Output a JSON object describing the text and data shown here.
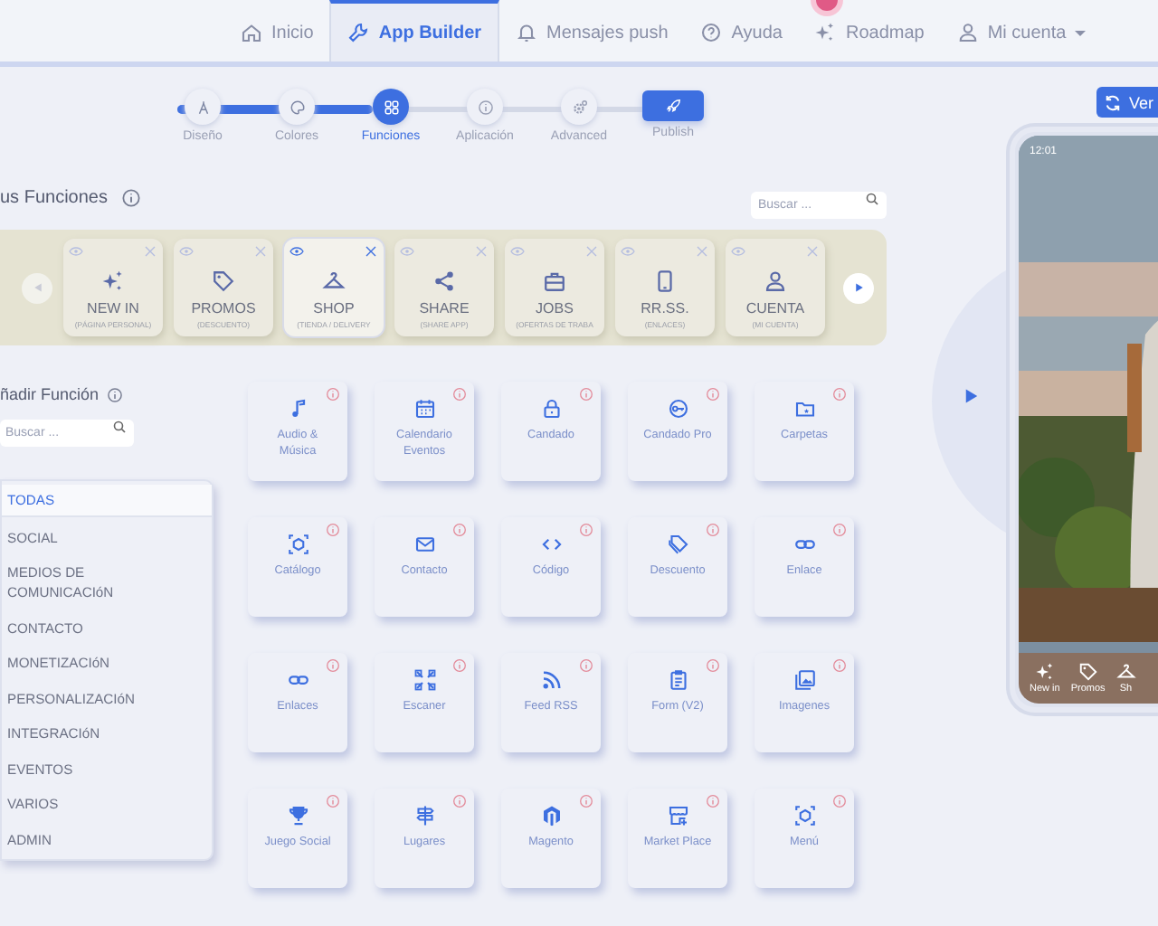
{
  "nav": {
    "items": [
      {
        "label": "Inicio",
        "selected": false
      },
      {
        "label": "App Builder",
        "selected": true
      },
      {
        "label": "Mensajes push",
        "selected": false
      },
      {
        "label": "Ayuda",
        "selected": false
      },
      {
        "label": "Roadmap",
        "selected": false
      },
      {
        "label": "Mi cuenta",
        "selected": false
      }
    ]
  },
  "stepper": {
    "steps": [
      {
        "label": "Diseño",
        "kind": "step",
        "done": true,
        "selected": false
      },
      {
        "label": "Colores",
        "kind": "step",
        "done": true,
        "selected": false
      },
      {
        "label": "Funciones",
        "kind": "step",
        "done": false,
        "selected": true
      },
      {
        "label": "Aplicación",
        "kind": "step",
        "done": false,
        "selected": false
      },
      {
        "label": "Advanced",
        "kind": "step",
        "done": false,
        "selected": false
      },
      {
        "label": "Publish",
        "kind": "button",
        "done": false,
        "selected": false
      }
    ]
  },
  "my_functions": {
    "title": "us Funciones",
    "search": {
      "placeholder": "Buscar ..."
    },
    "cards": [
      {
        "title": "NEW IN",
        "subtitle": "(PÁGINA PERSONAL)",
        "selected": false
      },
      {
        "title": "PROMOS",
        "subtitle": "(DESCUENTO)",
        "selected": false
      },
      {
        "title": "SHOP",
        "subtitle": "(TIENDA / DELIVERY",
        "selected": true
      },
      {
        "title": "SHARE",
        "subtitle": "(SHARE APP)",
        "selected": false
      },
      {
        "title": "JOBS",
        "subtitle": "(OFERTAS DE TRABA",
        "selected": false
      },
      {
        "title": "RR.SS.",
        "subtitle": "(ENLACES)",
        "selected": false
      },
      {
        "title": "CUENTA",
        "subtitle": "(MI CUENTA)",
        "selected": false
      }
    ]
  },
  "add_function": {
    "title": "ñadir Función",
    "search": {
      "placeholder": "Buscar ..."
    },
    "categories": [
      {
        "label": "TODAS",
        "selected": true
      },
      {
        "label": "SOCIAL",
        "selected": false
      },
      {
        "label": "MEDIOS DE COMUNICACIóN",
        "selected": false
      },
      {
        "label": "CONTACTO",
        "selected": false
      },
      {
        "label": "MONETIZACIóN",
        "selected": false
      },
      {
        "label": "PERSONALIZACIóN",
        "selected": false
      },
      {
        "label": "INTEGRACIóN",
        "selected": false
      },
      {
        "label": "EVENTOS",
        "selected": false
      },
      {
        "label": "VARIOS",
        "selected": false
      },
      {
        "label": "ADMIN",
        "selected": false
      }
    ],
    "functions": [
      {
        "label": "Audio & Música"
      },
      {
        "label": "Calendario Eventos"
      },
      {
        "label": "Candado"
      },
      {
        "label": "Candado Pro"
      },
      {
        "label": "Carpetas"
      },
      {
        "label": "Catálogo"
      },
      {
        "label": "Contacto"
      },
      {
        "label": "Código"
      },
      {
        "label": "Descuento"
      },
      {
        "label": "Enlace"
      },
      {
        "label": "Enlaces"
      },
      {
        "label": "Escaner"
      },
      {
        "label": "Feed RSS"
      },
      {
        "label": "Form (V2)"
      },
      {
        "label": "Imagenes"
      },
      {
        "label": "Juego Social"
      },
      {
        "label": "Lugares"
      },
      {
        "label": "Magento"
      },
      {
        "label": "Market Place"
      },
      {
        "label": "Menú"
      }
    ]
  },
  "preview": {
    "button": "Ver",
    "clock": "12:01",
    "tabs": [
      {
        "label": "New in"
      },
      {
        "label": "Promos"
      },
      {
        "label": "Sh"
      }
    ]
  }
}
